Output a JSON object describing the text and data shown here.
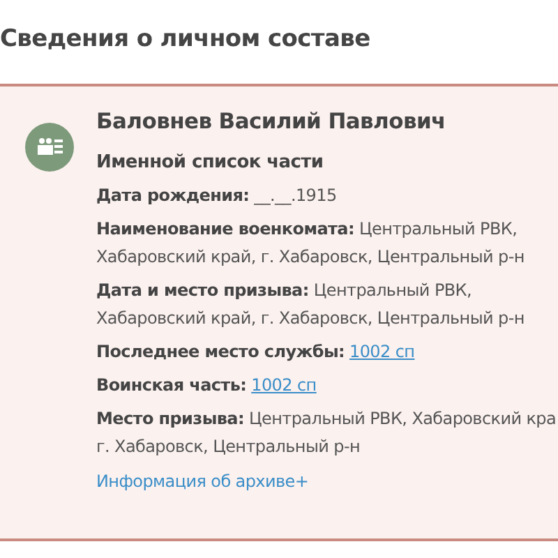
{
  "heading": "Сведения о личном составе",
  "person": {
    "name": "Баловнев Василий Павлович",
    "source": "Именной список части",
    "fields": [
      {
        "label": "Дата рождения:",
        "value": "__.__.1915",
        "kind": "text"
      },
      {
        "label": "Наименование военкомата:",
        "value": "Центральный РВК, Хабаровский край, г. Хабаровск, Центральный р-н",
        "kind": "text"
      },
      {
        "label": "Дата и место призыва:",
        "value": "Центральный РВК, Хабаровский край, г. Хабаровск, Центральный р-н",
        "kind": "text"
      },
      {
        "label": "Последнее место службы:",
        "value": "1002 сп",
        "kind": "link"
      },
      {
        "label": "Воинская часть:",
        "value": "1002 сп",
        "kind": "link"
      },
      {
        "label": "Место призыва:",
        "value": "Центральный РВК, Хабаровский кра г. Хабаровск, Центральный р-н",
        "kind": "text"
      }
    ],
    "archive_link": "Информация об архиве+"
  }
}
